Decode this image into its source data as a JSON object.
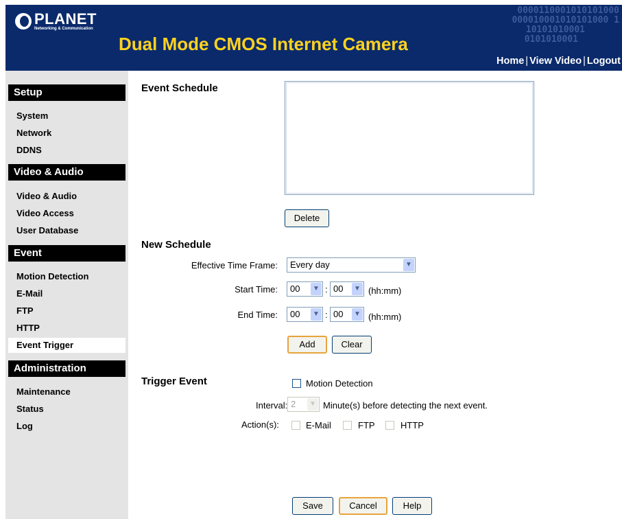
{
  "header": {
    "logo_name": "PLANET",
    "logo_tagline": "Networking & Communication",
    "title": "Dual Mode CMOS Internet Camera",
    "nav": [
      "Home",
      "View Video",
      "Logout"
    ],
    "binary_lines": [
      "0000110001010101000",
      "000010001010101000 1",
      "10101010001",
      "0101010001"
    ]
  },
  "sidebar": {
    "sections": [
      {
        "title": "Setup",
        "items": [
          "System",
          "Network",
          "DDNS"
        ]
      },
      {
        "title": "Video & Audio",
        "items": [
          "Video & Audio",
          "Video Access",
          "User Database"
        ]
      },
      {
        "title": "Event",
        "items": [
          "Motion Detection",
          "E-Mail",
          "FTP",
          "HTTP",
          "Event Trigger"
        ]
      },
      {
        "title": "Administration",
        "items": [
          "Maintenance",
          "Status",
          "Log"
        ]
      }
    ],
    "active_item": "Event Trigger"
  },
  "schedule": {
    "heading": "Event Schedule",
    "delete_label": "Delete"
  },
  "new_schedule": {
    "heading": "New Schedule",
    "time_frame_label": "Effective Time Frame:",
    "time_frame_value": "Every day",
    "start_label": "Start Time:",
    "start_hour": "00",
    "start_min": "00",
    "end_label": "End Time:",
    "end_hour": "00",
    "end_min": "00",
    "colon": ":",
    "unit": "(hh:mm)",
    "add_label": "Add",
    "clear_label": "Clear"
  },
  "trigger": {
    "heading": "Trigger Event",
    "motion_label": "Motion Detection",
    "interval_label": "Interval:",
    "interval_value": "2",
    "interval_suffix": "Minute(s) before detecting the next event.",
    "actions_label": "Action(s):",
    "actions": [
      "E-Mail",
      "FTP",
      "HTTP"
    ]
  },
  "footer": {
    "save_label": "Save",
    "cancel_label": "Cancel",
    "help_label": "Help"
  },
  "colors": {
    "header_bg": "#0a2a6b",
    "title": "#ffd21f",
    "sidebar_bg": "#e4e4e4"
  }
}
